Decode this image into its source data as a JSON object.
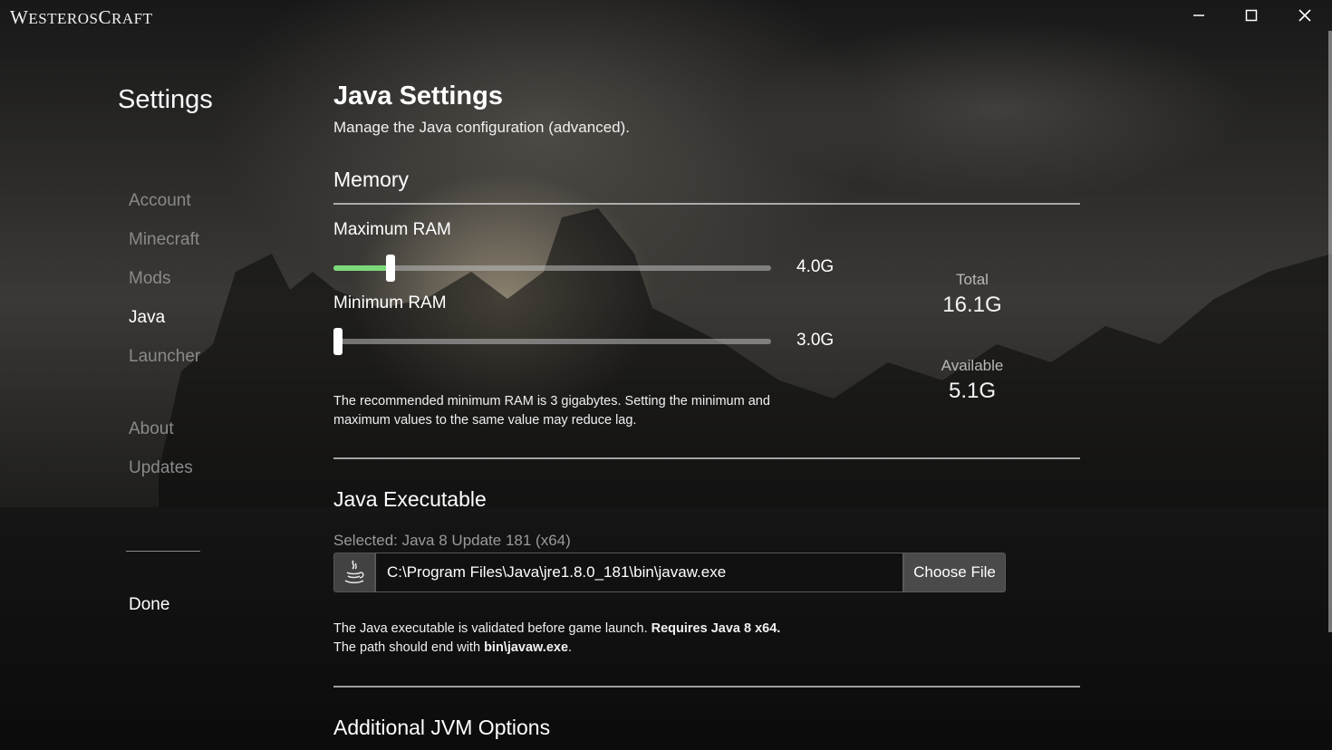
{
  "app": {
    "logo_first": "W",
    "logo_rest1": "ESTEROS",
    "logo_second": "C",
    "logo_rest2": "RAFT"
  },
  "window_controls": [
    "minimize-icon",
    "maximize-icon",
    "close-icon"
  ],
  "sidebar": {
    "title": "Settings",
    "items": [
      {
        "label": "Account",
        "active": false
      },
      {
        "label": "Minecraft",
        "active": false
      },
      {
        "label": "Mods",
        "active": false
      },
      {
        "label": "Java",
        "active": true
      },
      {
        "label": "Launcher",
        "active": false
      },
      {
        "label": "About",
        "active": false
      },
      {
        "label": "Updates",
        "active": false
      }
    ],
    "done_label": "Done"
  },
  "main": {
    "title": "Java Settings",
    "subtitle": "Manage the Java configuration (advanced).",
    "memory": {
      "heading": "Memory",
      "max_ram": {
        "label": "Maximum RAM",
        "value": "4.0G",
        "fraction": 0.13
      },
      "min_ram": {
        "label": "Minimum RAM",
        "value": "3.0G",
        "fraction": 0.01
      },
      "total": {
        "label": "Total",
        "value": "16.1G"
      },
      "available": {
        "label": "Available",
        "value": "5.1G"
      },
      "note_line1": "The recommended minimum RAM is 3 gigabytes. Setting the minimum and",
      "note_line2": "maximum values to the same value may reduce lag."
    },
    "java_executable": {
      "heading": "Java Executable",
      "selected": "Selected: Java 8 Update 181 (x64)",
      "path": "C:\\Program Files\\Java\\jre1.8.0_181\\bin\\javaw.exe",
      "icon": "java-cup-icon",
      "choose_label": "Choose File",
      "note1_text": "The Java executable is validated before game launch. ",
      "note1_bold": "Requires Java 8 x64.",
      "note2_text": "The path should end with ",
      "note2_bold": "bin\\javaw.exe",
      "note2_end": "."
    },
    "jvm_options": {
      "heading": "Additional JVM Options"
    }
  },
  "colors": {
    "slider_fill": "#7cd97a",
    "accent_text": "#ffffff",
    "muted_text": "#8a8a8a"
  }
}
